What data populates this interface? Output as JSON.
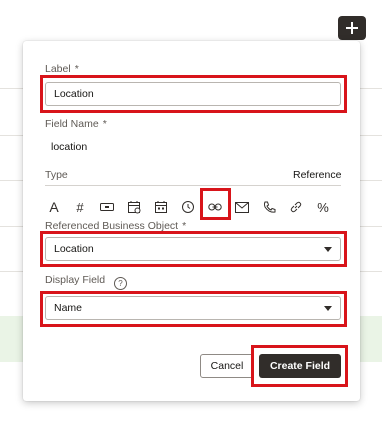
{
  "background": {
    "add_button_label": "+"
  },
  "form": {
    "label_field": {
      "label": "Label",
      "required_mark": "*",
      "value": "Location"
    },
    "field_name": {
      "label": "Field Name",
      "required_mark": "*",
      "value": "location"
    },
    "type": {
      "label": "Type",
      "selected_type_name": "Reference",
      "icons": [
        "text-icon",
        "number-icon",
        "currency-icon",
        "date-icon",
        "calendar-icon",
        "time-icon",
        "link-icon",
        "email-icon",
        "phone-icon",
        "url-icon",
        "percent-icon"
      ],
      "selected_icon": "link-icon"
    },
    "referenced_business_object": {
      "label": "Referenced Business Object",
      "required_mark": "*",
      "value": "Location"
    },
    "display_field": {
      "label": "Display Field",
      "help_icon": "help-icon",
      "value": "Name"
    },
    "buttons": {
      "cancel": "Cancel",
      "create": "Create Field"
    }
  },
  "colors": {
    "highlight": "#d8141a",
    "primary_button": "#312d2a"
  }
}
